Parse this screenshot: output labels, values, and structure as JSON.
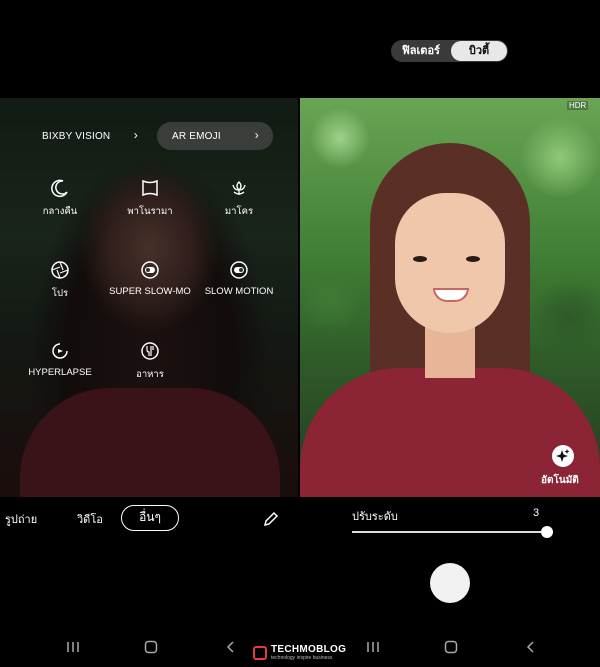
{
  "left_phone": {
    "quick_modes": [
      {
        "label": "BIXBY VISION",
        "icon": "chevron-right-icon"
      },
      {
        "label": "AR EMOJI",
        "icon": "chevron-right-icon"
      }
    ],
    "modes": [
      {
        "label": "กลางคืน",
        "icon": "moon-icon"
      },
      {
        "label": "พาโนรามา",
        "icon": "panorama-icon"
      },
      {
        "label": "มาโคร",
        "icon": "flower-icon"
      },
      {
        "label": "โปร",
        "icon": "aperture-icon"
      },
      {
        "label": "SUPER SLOW-MO",
        "icon": "super-slow-mo-icon"
      },
      {
        "label": "SLOW MOTION",
        "icon": "slow-motion-icon"
      },
      {
        "label": "HYPERLAPSE",
        "icon": "hyperlapse-icon"
      },
      {
        "label": "อาหาร",
        "icon": "food-icon"
      }
    ],
    "bottom_bar": {
      "photo": "รูปถ่าย",
      "video": "วิดีโอ",
      "other": "อื่นๆ"
    }
  },
  "right_phone": {
    "toggle": {
      "filter": "ฟิลเตอร์",
      "beauty": "บิวตี้"
    },
    "hdr": "HDR",
    "auto_label": "อัตโนมัติ",
    "adjust": {
      "label": "ปรับระดับ",
      "value": "3",
      "level_fraction": 1.0
    }
  },
  "watermark": {
    "name": "TECHMOBLOG",
    "tagline": "technology inspire business"
  },
  "colors": {
    "accent": "#ffffff",
    "toggle_active": "#e8e8e8",
    "watermark_red": "#e23b3b"
  }
}
